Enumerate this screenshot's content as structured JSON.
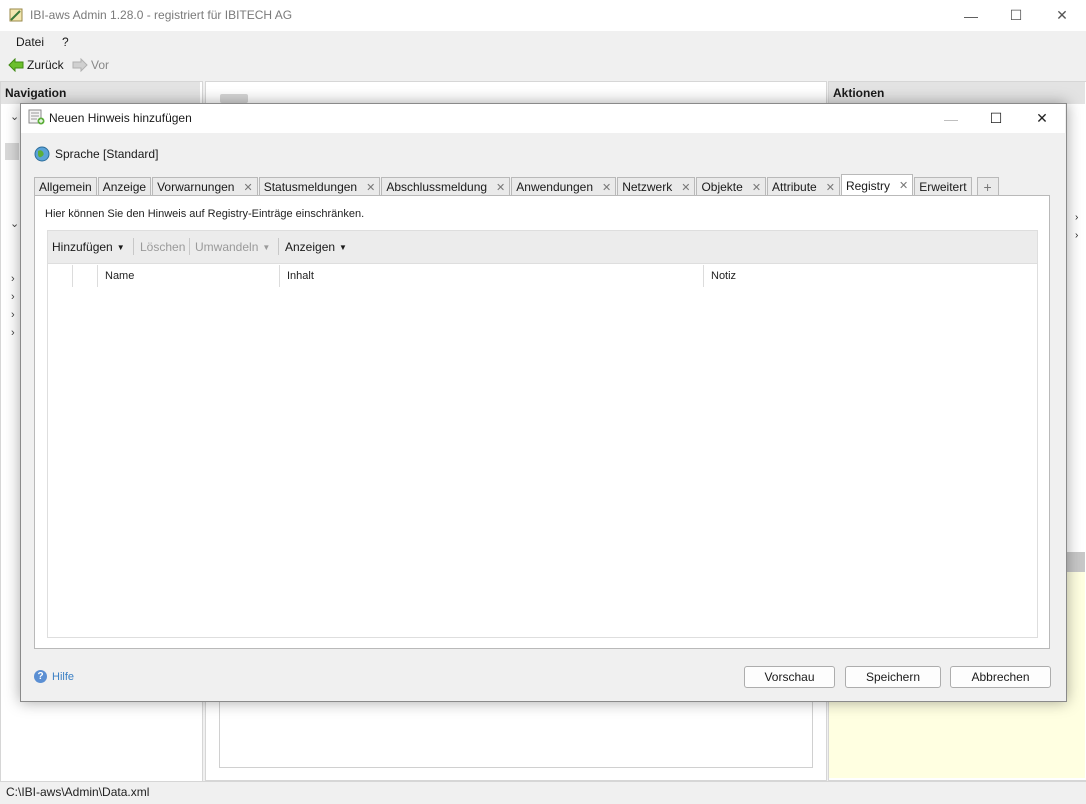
{
  "window": {
    "title": "IBI-aws Admin 1.28.0 - registriert für IBITECH AG",
    "minimize": "—",
    "maximize": "☐",
    "close": "✕"
  },
  "menu": {
    "items": [
      "Datei",
      "?"
    ]
  },
  "navbar": {
    "back": "Zurück",
    "forward": "Vor"
  },
  "navigation": {
    "header": "Navigation"
  },
  "actions": {
    "header": "Aktionen"
  },
  "status": {
    "path": "C:\\IBI-aws\\Admin\\Data.xml"
  },
  "dialog": {
    "title": "Neuen Hinweis hinzufügen",
    "language": "Sprache [Standard]",
    "tabs": [
      {
        "label": "Allgemein",
        "closable": false
      },
      {
        "label": "Anzeige",
        "closable": false
      },
      {
        "label": "Vorwarnungen",
        "closable": true
      },
      {
        "label": "Statusmeldungen",
        "closable": true
      },
      {
        "label": "Abschlussmeldung",
        "closable": true
      },
      {
        "label": "Anwendungen",
        "closable": true
      },
      {
        "label": "Netzwerk",
        "closable": true
      },
      {
        "label": "Objekte",
        "closable": true
      },
      {
        "label": "Attribute",
        "closable": true
      },
      {
        "label": "Registry",
        "closable": true,
        "active": true
      },
      {
        "label": "Erweitert",
        "closable": false
      }
    ],
    "add_tab": "+",
    "hint": "Hier können Sie den Hinweis auf Registry-Einträge einschränken.",
    "toolbar": {
      "add": "Hinzufügen",
      "delete": "Löschen",
      "convert": "Umwandeln",
      "show": "Anzeigen"
    },
    "columns": [
      "Name",
      "Inhalt",
      "Notiz"
    ],
    "help": "Hilfe",
    "buttons": {
      "preview": "Vorschau",
      "save": "Speichern",
      "cancel": "Abbrechen"
    }
  }
}
